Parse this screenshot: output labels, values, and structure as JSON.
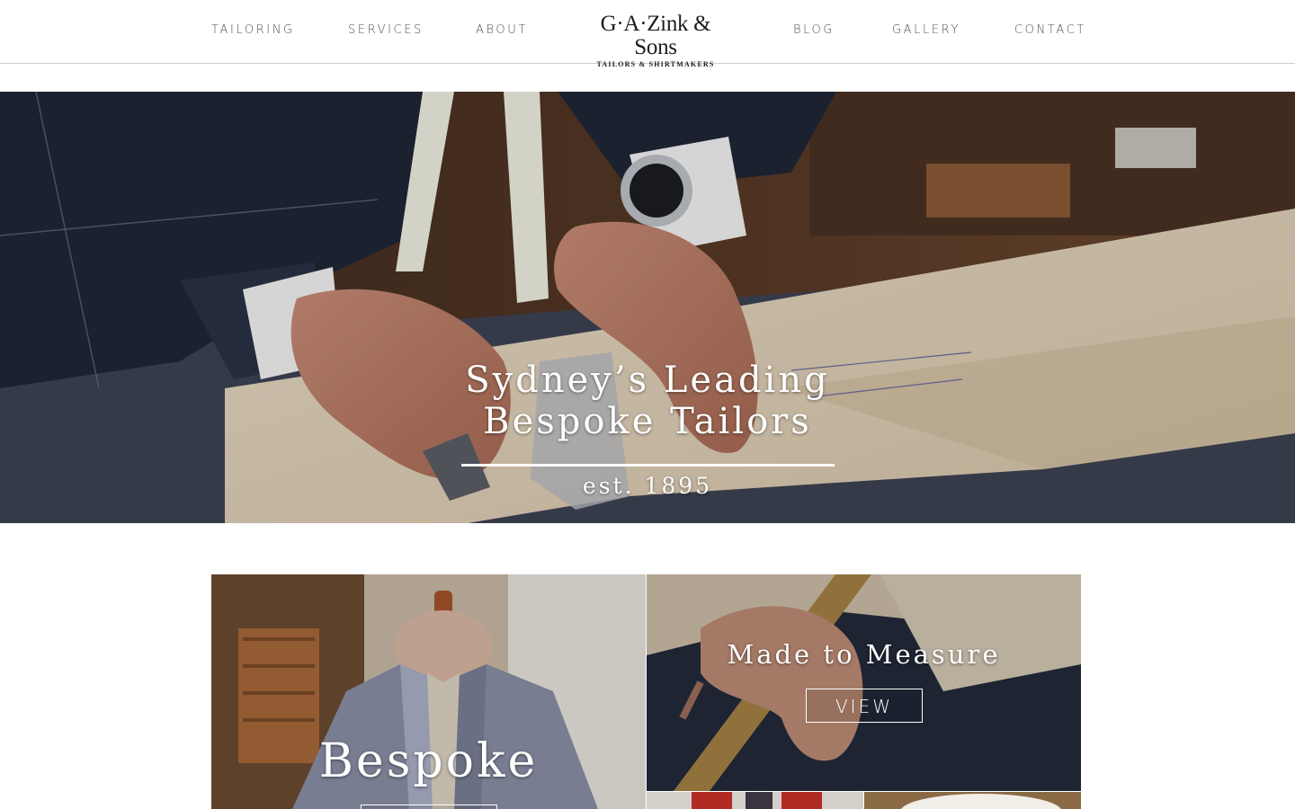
{
  "nav": {
    "left": [
      "TAILORING",
      "SERVICES",
      "ABOUT"
    ],
    "right": [
      "BLOG",
      "GALLERY",
      "CONTACT"
    ]
  },
  "logo": {
    "name": "G·A·Zink & Sons",
    "tagline": "TAILORS & SHIRTMAKERS"
  },
  "hero": {
    "title": "Sydney’s Leading Bespoke Tailors",
    "subtitle": "est. 1895",
    "slide_count": 5,
    "active_slide": 1,
    "dot_color": "#1aa3e8",
    "dot_active_color": "#7fd0f5"
  },
  "tiles": {
    "bespoke": {
      "title": "Bespoke"
    },
    "made_to_measure": {
      "title": "Made to Measure",
      "button": "VIEW"
    }
  }
}
